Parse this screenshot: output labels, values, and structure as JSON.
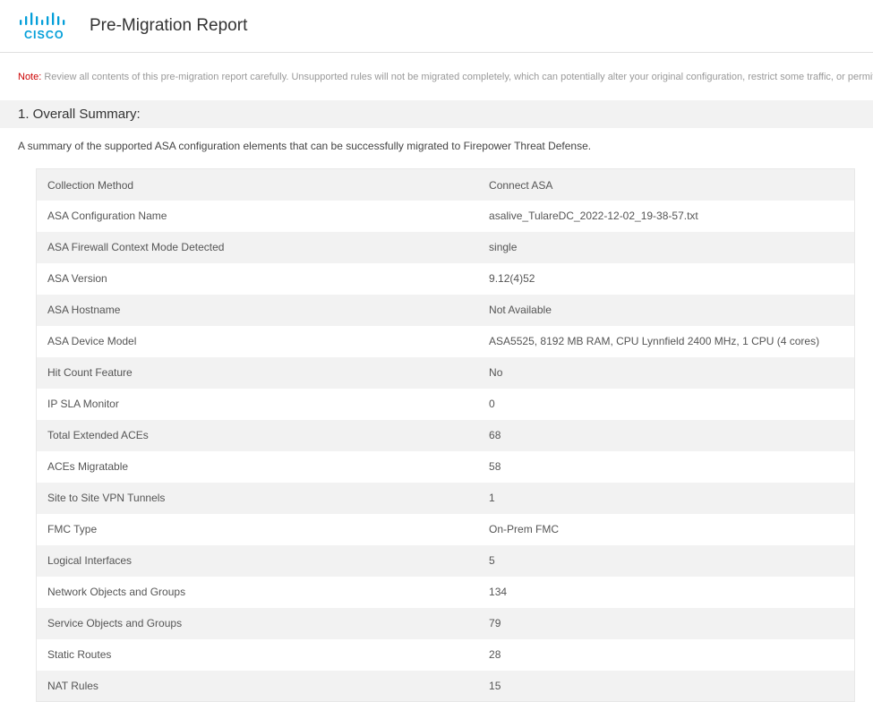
{
  "header": {
    "page_title": "Pre-Migration Report"
  },
  "note": {
    "label": "Note:",
    "text": "Review all contents of this pre-migration report carefully. Unsupported rules will not be migrated completely, which can potentially alter your original configuration, restrict some traffic, or permit unwanted traffic. We recommend that you update the related rules ac"
  },
  "section": {
    "heading": "1. Overall Summary:",
    "description": "A summary of the supported ASA configuration elements that can be successfully migrated to Firepower Threat Defense."
  },
  "summary_rows": [
    {
      "label": "Collection Method",
      "value": "Connect ASA"
    },
    {
      "label": "ASA Configuration Name",
      "value": "asalive_TulareDC_2022-12-02_19-38-57.txt"
    },
    {
      "label": "ASA Firewall Context Mode Detected",
      "value": "single"
    },
    {
      "label": "ASA Version",
      "value": "9.12(4)52"
    },
    {
      "label": "ASA Hostname",
      "value": "Not Available"
    },
    {
      "label": "ASA Device Model",
      "value": "ASA5525, 8192 MB RAM, CPU Lynnfield 2400 MHz, 1 CPU (4 cores)"
    },
    {
      "label": "Hit Count Feature",
      "value": "No"
    },
    {
      "label": "IP SLA Monitor",
      "value": "0"
    },
    {
      "label": "Total Extended ACEs",
      "value": "68"
    },
    {
      "label": "ACEs Migratable",
      "value": "58"
    },
    {
      "label": "Site to Site VPN Tunnels",
      "value": "1"
    },
    {
      "label": "FMC Type",
      "value": "On-Prem FMC"
    },
    {
      "label": "Logical Interfaces",
      "value": "5"
    },
    {
      "label": "Network Objects and Groups",
      "value": "134"
    },
    {
      "label": "Service Objects and Groups",
      "value": "79"
    },
    {
      "label": "Static Routes",
      "value": "28"
    },
    {
      "label": "NAT Rules",
      "value": "15"
    }
  ],
  "chart_data": {
    "type": "table",
    "title": "Overall Summary",
    "rows": [
      {
        "label": "Collection Method",
        "value": "Connect ASA"
      },
      {
        "label": "ASA Configuration Name",
        "value": "asalive_TulareDC_2022-12-02_19-38-57.txt"
      },
      {
        "label": "ASA Firewall Context Mode Detected",
        "value": "single"
      },
      {
        "label": "ASA Version",
        "value": "9.12(4)52"
      },
      {
        "label": "ASA Hostname",
        "value": "Not Available"
      },
      {
        "label": "ASA Device Model",
        "value": "ASA5525, 8192 MB RAM, CPU Lynnfield 2400 MHz, 1 CPU (4 cores)"
      },
      {
        "label": "Hit Count Feature",
        "value": "No"
      },
      {
        "label": "IP SLA Monitor",
        "value": 0
      },
      {
        "label": "Total Extended ACEs",
        "value": 68
      },
      {
        "label": "ACEs Migratable",
        "value": 58
      },
      {
        "label": "Site to Site VPN Tunnels",
        "value": 1
      },
      {
        "label": "FMC Type",
        "value": "On-Prem FMC"
      },
      {
        "label": "Logical Interfaces",
        "value": 5
      },
      {
        "label": "Network Objects and Groups",
        "value": 134
      },
      {
        "label": "Service Objects and Groups",
        "value": 79
      },
      {
        "label": "Static Routes",
        "value": 28
      },
      {
        "label": "NAT Rules",
        "value": 15
      }
    ]
  }
}
